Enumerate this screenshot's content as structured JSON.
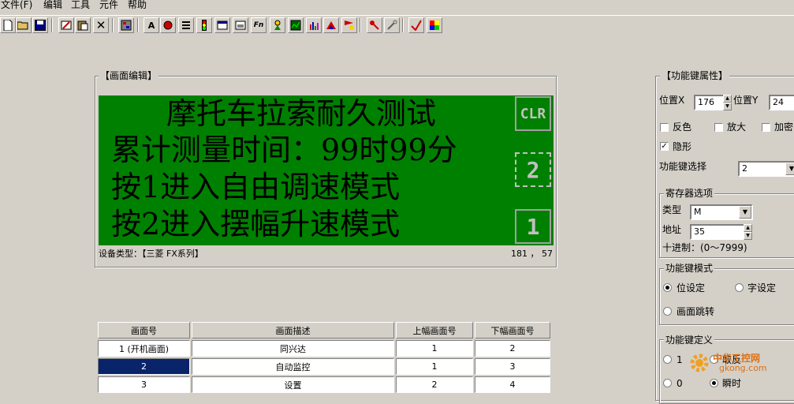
{
  "menu": [
    "文件(F)",
    "编辑",
    "工具",
    "元件",
    "帮助"
  ],
  "toolbar_icons": [
    "new-file-icon",
    "open-folder-icon",
    "save-icon",
    "edit-icon",
    "paste-icon",
    "delete-icon",
    "screen-icon",
    "text-icon",
    "indicator-icon",
    "list-icon",
    "traffic-light-icon",
    "window-icon",
    "window2-icon",
    "fn-icon",
    "wizard-icon",
    "chart-icon",
    "bar-chart-icon",
    "flag-icon",
    "alarm-icon",
    "key-icon",
    "tools-icon",
    "download-icon",
    "color-icon"
  ],
  "editor": {
    "title": "【画面编辑】",
    "lines": [
      "摩托车拉索耐久测试",
      "累计测量时间：99时99分",
      "按1进入自由调速模式",
      "按2进入摆幅升速模式"
    ],
    "buttons": [
      "CLR",
      "2",
      "1"
    ],
    "device_label": "设备类型：【三菱 FX系列】",
    "coords": "181 ， 57"
  },
  "table": {
    "headers": [
      "画面号",
      "画面描述",
      "上幅画面号",
      "下幅画面号"
    ],
    "rows": [
      [
        "1 (开机画面)",
        "同兴达",
        "1",
        "2"
      ],
      [
        "2",
        "自动监控",
        "1",
        "3"
      ],
      [
        "3",
        "设置",
        "2",
        "4"
      ]
    ]
  },
  "props": {
    "title": "【功能键属性】",
    "pos_x_label": "位置X",
    "pos_x": "176",
    "pos_y_label": "位置Y",
    "pos_y": "24",
    "invert_label": "反色",
    "zoom_label": "放大",
    "encrypt_label": "加密",
    "hidden_label": "隐形",
    "hidden_checked": "✓",
    "key_select_label": "功能键选择",
    "key_select": "2",
    "register_group": "寄存器选项",
    "type_label": "类型",
    "type_value": "M",
    "address_label": "地址",
    "address_value": "35",
    "decimal_hint": "十进制：(0～7999)",
    "mode_group": "功能键模式",
    "bit_set": "位设定",
    "word_set": "字设定",
    "screen_jump": "画面跳转",
    "def_group": "功能键定义",
    "def_1": "1",
    "def_invert": "取反",
    "def_0": "0",
    "def_instant": "瞬时"
  },
  "watermark": {
    "text": "中华工控网",
    "url": "gkong.com"
  }
}
